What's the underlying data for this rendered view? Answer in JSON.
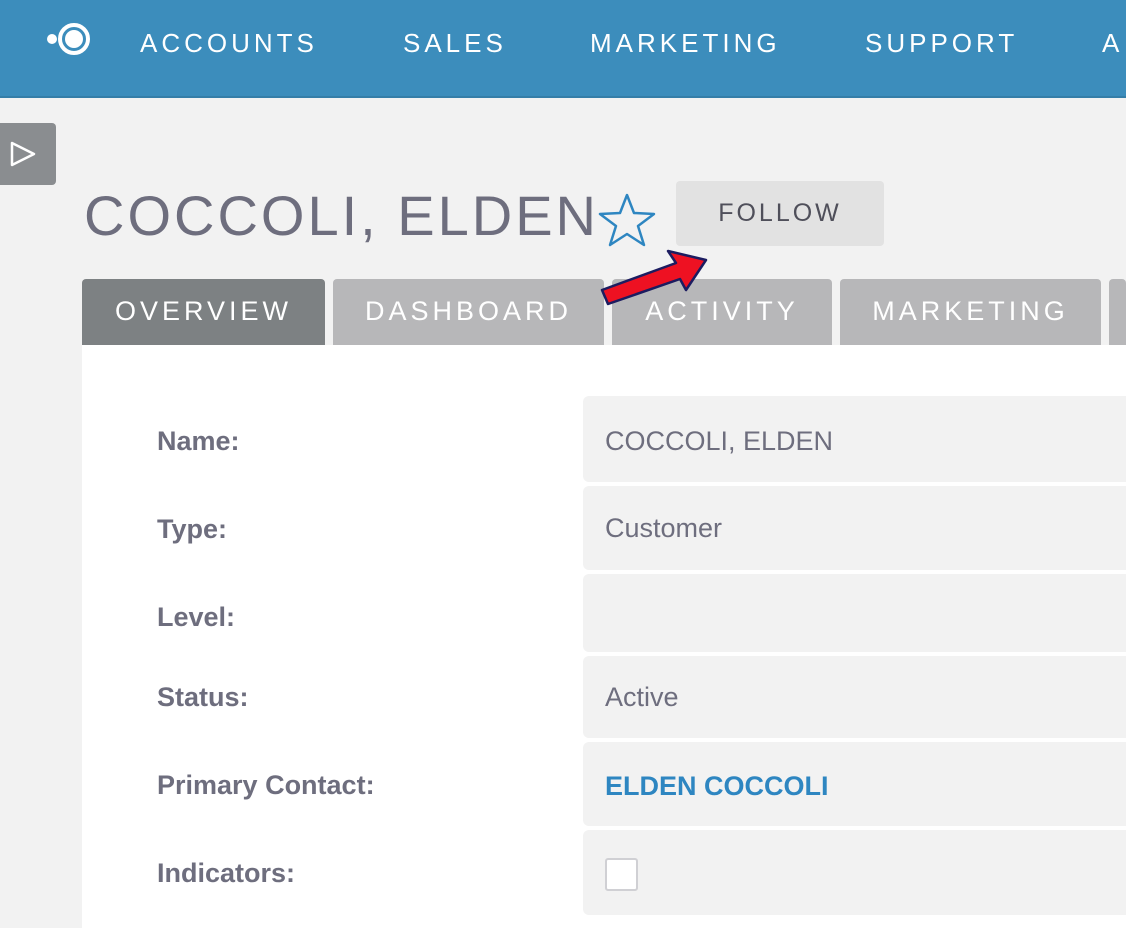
{
  "nav": {
    "items": [
      "ACCOUNTS",
      "SALES",
      "MARKETING",
      "SUPPORT",
      "A"
    ]
  },
  "record": {
    "title": "COCCOLI, ELDEN",
    "follow_label": "FOLLOW"
  },
  "tabs": [
    {
      "label": "OVERVIEW",
      "active": true
    },
    {
      "label": "DASHBOARD",
      "active": false
    },
    {
      "label": "ACTIVITY",
      "active": false
    },
    {
      "label": "MARKETING",
      "active": false
    }
  ],
  "fields": {
    "name": {
      "label": "Name:",
      "value": "COCCOLI, ELDEN"
    },
    "type": {
      "label": "Type:",
      "value": "Customer"
    },
    "level": {
      "label": "Level:",
      "value": ""
    },
    "status": {
      "label": "Status:",
      "value": "Active"
    },
    "primary_contact": {
      "label": "Primary Contact:",
      "value": "ELDEN COCCOLI"
    },
    "indicators": {
      "label": "Indicators:",
      "checked": false
    }
  },
  "icons": {
    "logo": "app-logo-icon",
    "sidebar_toggle": "play-triangle-icon",
    "favorite": "star-outline-icon",
    "annotation": "red-arrow-icon"
  },
  "colors": {
    "brand": "#3c8dbc",
    "tab_active": "#7d8183",
    "tab_inactive": "#b7b7b9",
    "link": "#2e86c1",
    "arrow": "#ee1122"
  }
}
